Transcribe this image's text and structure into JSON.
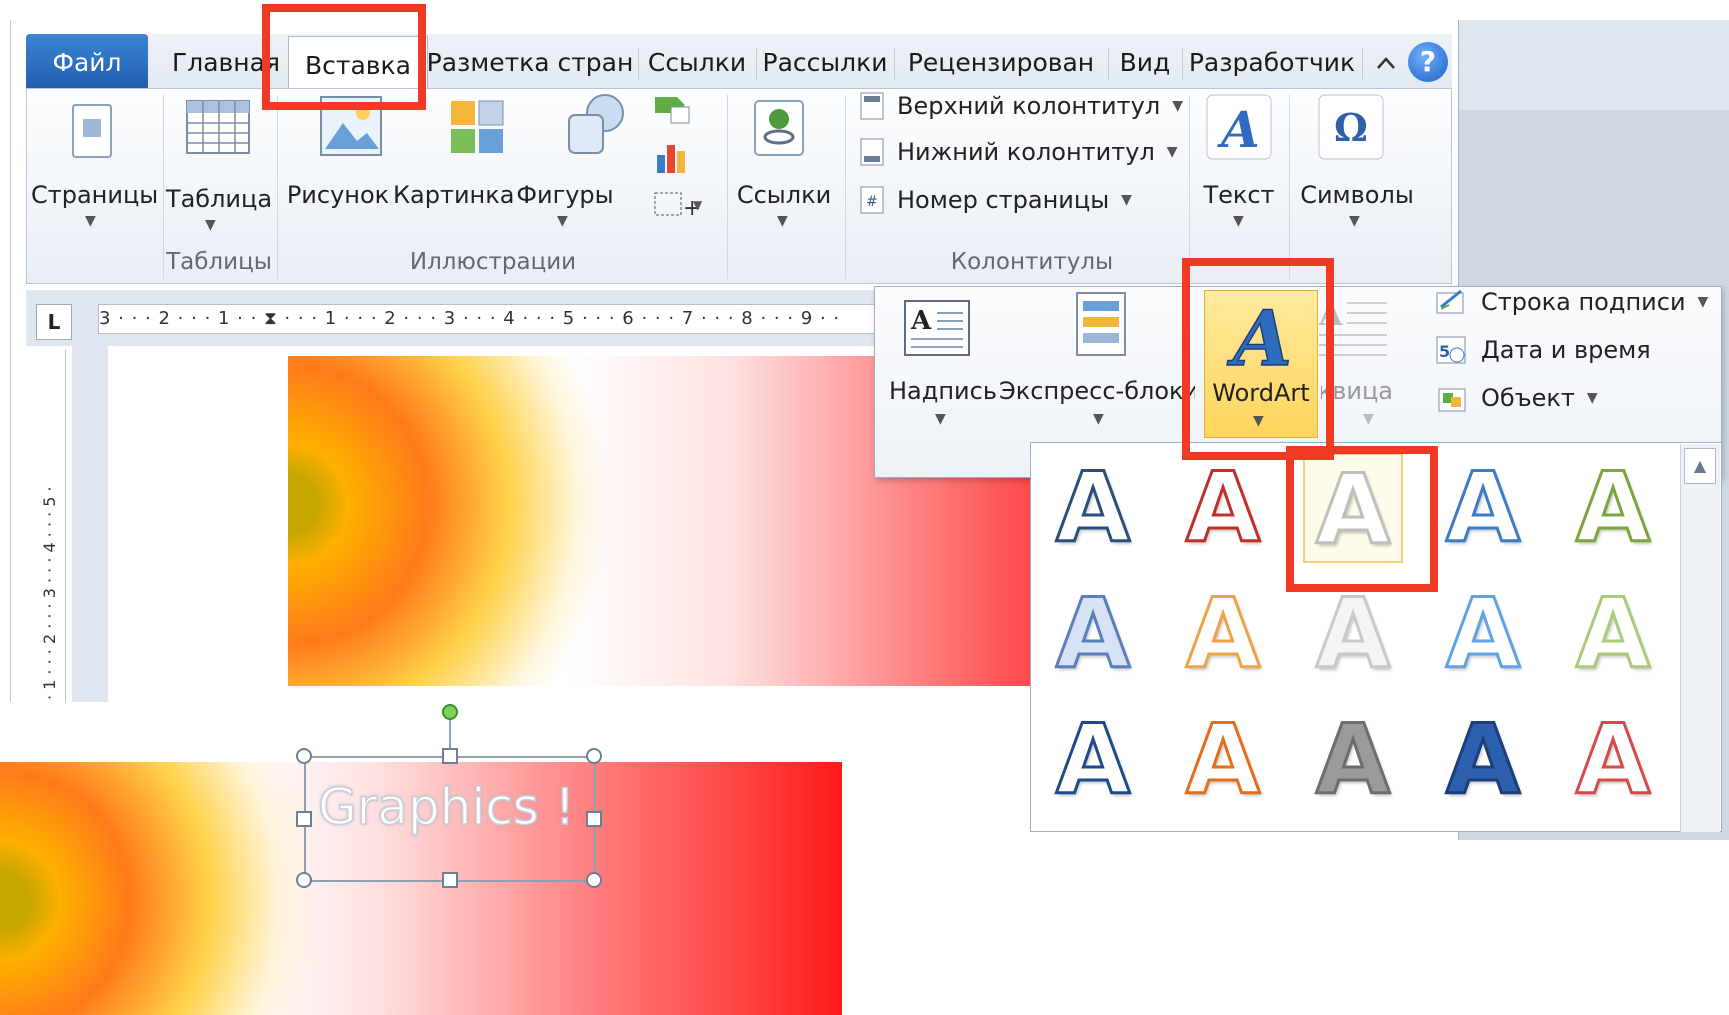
{
  "tabs": {
    "file": "Файл",
    "home": "Главная",
    "insert": "Вставка",
    "layout": "Разметка стран",
    "references": "Ссылки",
    "mailings": "Рассылки",
    "review": "Рецензирован",
    "view": "Вид",
    "developer": "Разработчик",
    "help_icon": "help-icon",
    "collapse_icon": "chevron-up-icon"
  },
  "ribbon": {
    "pages": "Страницы",
    "table": "Таблица",
    "tables_group": "Таблицы",
    "picture": "Рисунок",
    "clipart": "Картинка",
    "shapes": "Фигуры",
    "illustrations_group": "Иллюстрации",
    "links": "Ссылки",
    "header": "Верхний колонтитул",
    "footer": "Нижний колонтитул",
    "page_number": "Номер страницы",
    "headers_group": "Колонтитулы",
    "text": "Текст",
    "symbols": "Символы"
  },
  "text_panel": {
    "textbox": "Надпись",
    "quickparts": "Экспресс-блоки",
    "wordart": "WordArt",
    "dropcap": "Буквица",
    "signature_line": "Строка подписи",
    "date_time": "Дата и время",
    "object": "Объект"
  },
  "ruler": {
    "corner": "L",
    "marks": "3 · · · 2 · · · 1 · · ⧗ · · · 1 · · · 2 · · · 3 · · · 4 · · · 5 · · · 6 · · · 7 · · · 8 · · · 9 · ·",
    "vmarks": "· 1 · · · 2 · · · 3 · · · 4 · · · 5 ·"
  },
  "document": {
    "wordart_text": "Graphics !"
  },
  "wordart_gallery": {
    "styles": [
      {
        "glyph": "A",
        "fill": "#ffffff",
        "stroke": "#2b4e7a",
        "name": "style-1"
      },
      {
        "glyph": "A",
        "fill": "#ffffff",
        "stroke": "#c0302a",
        "name": "style-2"
      },
      {
        "glyph": "A",
        "fill": "#ffffff",
        "stroke": "#bfbfbf",
        "name": "style-3"
      },
      {
        "glyph": "A",
        "fill": "#ffffff",
        "stroke": "#3a7cc8",
        "name": "style-4"
      },
      {
        "glyph": "A",
        "fill": "#ffffff",
        "stroke": "#7aa63a",
        "name": "style-5"
      },
      {
        "glyph": "A",
        "fill": "#d7e3f5",
        "stroke": "#5a7fbf",
        "name": "style-6"
      },
      {
        "glyph": "A",
        "fill": "#ffffff",
        "stroke": "#f0a24a",
        "name": "style-7"
      },
      {
        "glyph": "A",
        "fill": "#f4f4f4",
        "stroke": "#c9c9c9",
        "name": "style-8"
      },
      {
        "glyph": "A",
        "fill": "#ffffff",
        "stroke": "#5fa3e6",
        "name": "style-9"
      },
      {
        "glyph": "A",
        "fill": "#ffffff",
        "stroke": "#a8cc7a",
        "name": "style-10"
      },
      {
        "glyph": "A",
        "fill": "#ffffff",
        "stroke": "#1e4a8c",
        "name": "style-11"
      },
      {
        "glyph": "A",
        "fill": "#ffffff",
        "stroke": "#e66e1a",
        "name": "style-12"
      },
      {
        "glyph": "A",
        "fill": "#9a9a9a",
        "stroke": "#6d6d6d",
        "name": "style-13"
      },
      {
        "glyph": "A",
        "fill": "#2c5fae",
        "stroke": "#1a3f7a",
        "name": "style-14"
      },
      {
        "glyph": "A",
        "fill": "#ffffff",
        "stroke": "#d64a4a",
        "name": "style-15"
      }
    ],
    "selected_index": 2,
    "scroll_up": "▲"
  },
  "colors": {
    "highlight": "#f03a24",
    "file_tab": "#2a6bc2",
    "wordart_hover": "#ffd45a"
  }
}
